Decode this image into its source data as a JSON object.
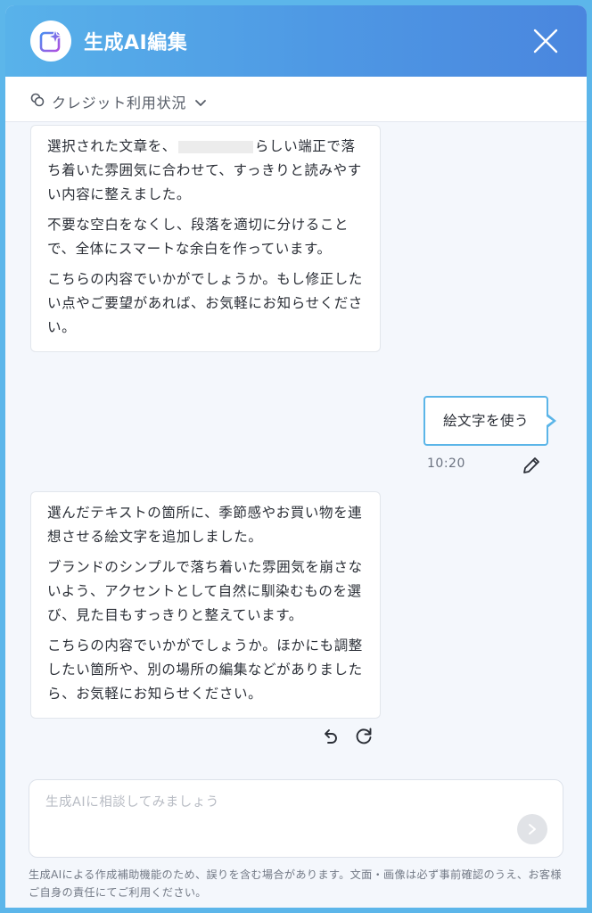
{
  "header": {
    "title": "生成AI編集",
    "logo_icon": "sparkle-image-icon",
    "close_icon": "close-icon"
  },
  "credit": {
    "label": "クレジット利用状況",
    "icon": "coins-icon",
    "chevron": "chevron-down-icon"
  },
  "messages": {
    "ai_1": {
      "p1_a": "選択された文章を、",
      "p1_b": "らしい端正で落ち着いた雰囲気に合わせて、すっきりと読みやすい内容に整えました。",
      "p2": "不要な空白をなくし、段落を適切に分けることで、全体にスマートな余白を作っています。",
      "p3": "こちらの内容でいかがでしょうか。もし修正したい点やご要望があれば、お気軽にお知らせください。"
    },
    "user_1": {
      "text": "絵文字を使う",
      "time": "10:20",
      "edit_icon": "pencil-icon"
    },
    "ai_2": {
      "p1": "選んだテキストの箇所に、季節感やお買い物を連想させる絵文字を追加しました。",
      "p2": "ブランドのシンプルで落ち着いた雰囲気を崩さないよう、アクセントとして自然に馴染むものを選び、見た目もすっきりと整えています。",
      "p3": "こちらの内容でいかがでしょうか。ほかにも調整したい箇所や、別の場所の編集などがありましたら、お気軽にお知らせください。",
      "undo_icon": "undo-icon",
      "redo_icon": "redo-icon"
    }
  },
  "composer": {
    "placeholder": "生成AIに相談してみましょう",
    "value": "",
    "send_icon": "send-arrow-icon"
  },
  "disclaimer": "生成AIによる作成補助機能のため、誤りを含む場合があります。文面・画像は必ず事前確認のうえ、お客様ご自身の責任にてご利用ください。",
  "colors": {
    "header_start": "#58b2ea",
    "header_end": "#4a86de",
    "accent": "#5bb5e8",
    "background": "#f4f7fc"
  }
}
